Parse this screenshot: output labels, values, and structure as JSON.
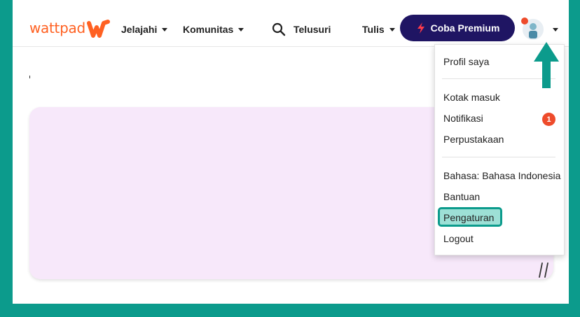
{
  "brand": {
    "logo_text": "wattpad",
    "accent_color": "#ff6122"
  },
  "nav": {
    "explore_label": "Jelajahi",
    "community_label": "Komunitas",
    "search_label": "Telusuri",
    "write_label": "Tulis",
    "premium_label": "Coba Premium",
    "premium_color": "#1f1563"
  },
  "dropdown": {
    "profile": "Profil saya",
    "inbox": "Kotak masuk",
    "notifications": "Notifikasi",
    "notifications_badge": "1",
    "library": "Perpustakaan",
    "language": "Bahasa: Bahasa Indonesia",
    "help": "Bantuan",
    "settings": "Pengaturan",
    "logout": "Logout"
  },
  "icons": {
    "search": "search-icon",
    "premium": "lightning-icon",
    "avatar": "avatar",
    "arrow": "up-arrow-annotation-icon"
  },
  "colors": {
    "frame": "#0c9b8c",
    "highlight": "#9de0d6",
    "card": "#f7e8fa",
    "badge": "#ee4b2b"
  }
}
